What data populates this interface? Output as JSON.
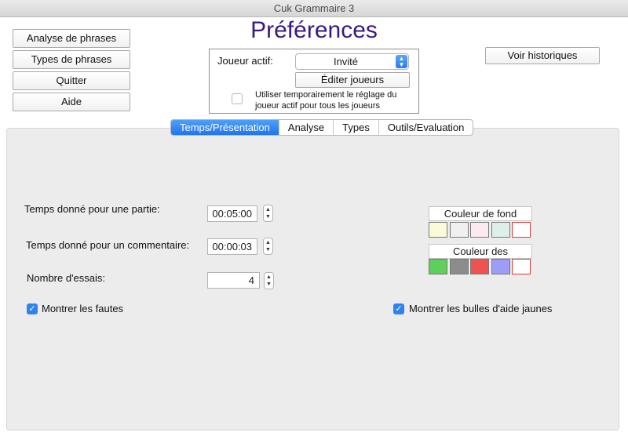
{
  "window": {
    "title": "Cuk Grammaire 3"
  },
  "left_buttons": [
    "Analyse de phrases",
    "Types de phrases",
    "Quitter",
    "Aide"
  ],
  "page_title": "Préférences",
  "history_button": "Voir historiques",
  "player": {
    "label": "Joueur actif:",
    "selected": "Invité",
    "edit_button": "Éditer joueurs",
    "temp_setting_line1": "Utiliser temporairement le réglage du",
    "temp_setting_line2": "joueur actif pour tous les joueurs",
    "temp_setting_checked": false
  },
  "tabs": [
    {
      "label": "Temps/Présentation",
      "active": true
    },
    {
      "label": "Analyse",
      "active": false
    },
    {
      "label": "Types",
      "active": false
    },
    {
      "label": "Outils/Evaluation",
      "active": false
    }
  ],
  "settings": {
    "game_time_label": "Temps donné pour une partie:",
    "game_time_value": "00:05:00",
    "comment_time_label": "Temps donné pour un commentaire:",
    "comment_time_value": "00:00:03",
    "tries_label": "Nombre d'essais:",
    "tries_value": "4",
    "show_errors_label": "Montrer les fautes",
    "show_errors_checked": true,
    "show_tooltips_label": "Montrer les bulles d'aide jaunes",
    "show_tooltips_checked": true
  },
  "colors": {
    "background_label": "Couleur de fond",
    "background_swatches": [
      "#fbfbdc",
      "#f0f0f0",
      "#fbeaf0",
      "#dcefe9",
      "#ffffff"
    ],
    "background_selected_index": 4,
    "text_label": "Couleur des",
    "text_swatches": [
      "#5fce5a",
      "#8c8c8c",
      "#f05252",
      "#9f9cf5",
      "#ffffff"
    ],
    "text_selected_index": 4,
    "selected_border": "#d73a3a"
  }
}
